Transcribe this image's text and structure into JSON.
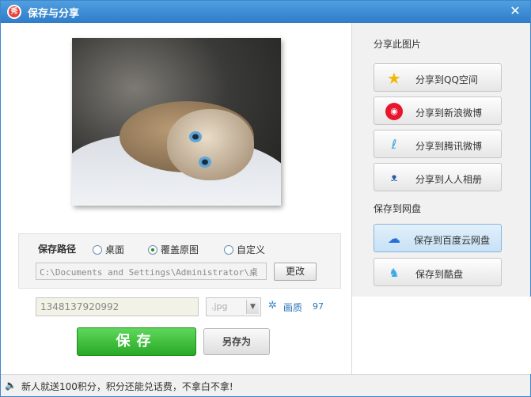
{
  "window": {
    "title": "保存与分享"
  },
  "save": {
    "path_label": "保存路径",
    "options": [
      {
        "label": "桌面",
        "selected": false
      },
      {
        "label": "覆盖原图",
        "selected": true
      },
      {
        "label": "自定义",
        "selected": false
      }
    ],
    "path_value": "C:\\Documents and Settings\\Administrator\\桌",
    "change_label": "更改",
    "filename": "1348137920992",
    "extension": ".jpg",
    "quality_label": "画质",
    "quality_value": "97",
    "save_label": "保存",
    "save_as_label": "另存为"
  },
  "share": {
    "heading": "分享此图片",
    "items": [
      {
        "label": "分享到QQ空间",
        "icon": "qzone-star-icon"
      },
      {
        "label": "分享到新浪微博",
        "icon": "sina-weibo-icon"
      },
      {
        "label": "分享到腾讯微博",
        "icon": "tencent-weibo-icon"
      },
      {
        "label": "分享到人人相册",
        "icon": "renren-icon"
      }
    ]
  },
  "cloud": {
    "heading": "保存到网盘",
    "items": [
      {
        "label": "保存到百度云网盘",
        "icon": "baidu-cloud-icon",
        "active": true
      },
      {
        "label": "保存到酷盘",
        "icon": "kupan-rabbit-icon",
        "active": false
      }
    ]
  },
  "status": {
    "text": "新人就送100积分，积分还能兑话费，不拿白不拿!"
  },
  "colors": {
    "titlebar": "#2f7cc9",
    "save_button": "#29a826",
    "link": "#2d74b8"
  }
}
